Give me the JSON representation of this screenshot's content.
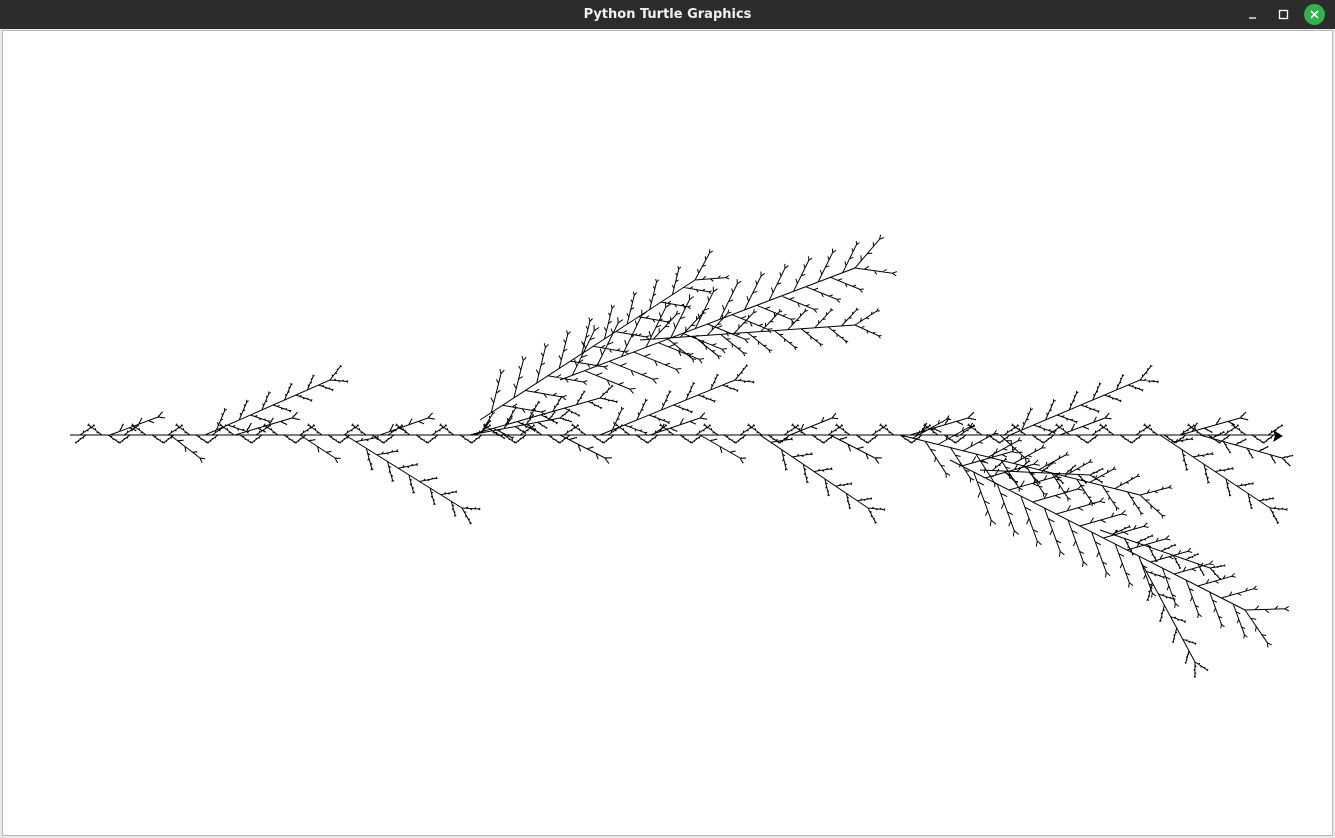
{
  "window": {
    "title": "Python Turtle Graphics",
    "controls": [
      {
        "name": "minimize",
        "icon": "minimize-icon"
      },
      {
        "name": "maximize",
        "icon": "maximize-icon"
      },
      {
        "name": "close",
        "icon": "close-icon",
        "color": "#2fb34a"
      }
    ]
  },
  "canvas": {
    "background": "#ffffff",
    "drawing": "fractal-tree-branches",
    "stroke_color": "#000000",
    "turtle_cursor": "turtle-arrow-icon"
  }
}
